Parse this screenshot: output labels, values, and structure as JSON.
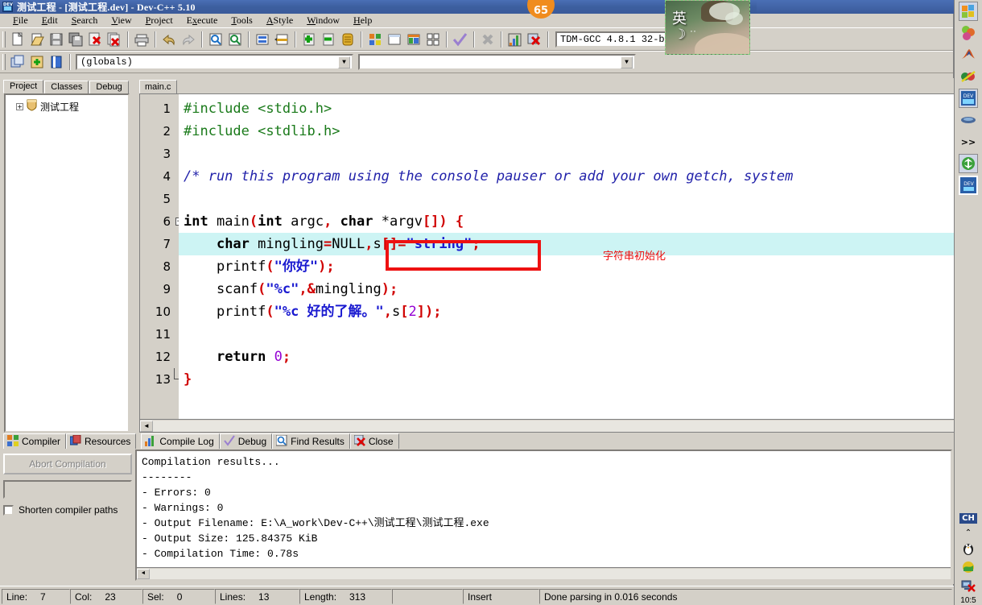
{
  "window": {
    "title": "测试工程 - [测试工程.dev] - Dev-C++ 5.10",
    "icon": "devcpp-icon"
  },
  "menubar": {
    "items": [
      {
        "label": "File",
        "accel": "F"
      },
      {
        "label": "Edit",
        "accel": "E"
      },
      {
        "label": "Search",
        "accel": "S"
      },
      {
        "label": "View",
        "accel": "V"
      },
      {
        "label": "Project",
        "accel": "P"
      },
      {
        "label": "Execute",
        "accel": "x"
      },
      {
        "label": "Tools",
        "accel": "T"
      },
      {
        "label": "AStyle",
        "accel": "A"
      },
      {
        "label": "Window",
        "accel": "W"
      },
      {
        "label": "Help",
        "accel": "H"
      }
    ]
  },
  "toolbar": {
    "row1_icons": [
      "new-file-icon",
      "open-file-icon",
      "save-icon",
      "save-all-icon",
      "close-file-icon",
      "close-all-icon",
      "print-icon",
      "undo-icon",
      "redo-icon",
      "find-icon",
      "find-next-icon",
      "goto-line-icon",
      "replace-icon",
      "add-to-project-icon",
      "remove-from-project-icon",
      "project-options-icon",
      "compile-icon",
      "run-icon",
      "compile-and-run-icon",
      "rebuild-all-icon",
      "syntax-check-icon",
      "stop-execution-icon",
      "profile-icon",
      "delete-profile-icon"
    ],
    "row2_icons": [
      "new-project-icon",
      "add-source-icon",
      "project-manager-icon"
    ],
    "compiler_selector": {
      "value": "TDM-GCC 4.8.1 32-bi",
      "arrow": "chevron-down-icon"
    }
  },
  "class_browser": {
    "value": "(globals)",
    "arrow": "chevron-down-icon",
    "secondary_value": "",
    "secondary_arrow": "chevron-down-icon"
  },
  "left_panel": {
    "tabs": [
      {
        "label": "Project",
        "active": true
      },
      {
        "label": "Classes",
        "active": false
      },
      {
        "label": "Debug",
        "active": false
      }
    ],
    "tree": {
      "expander": "+",
      "icon": "project-shield-icon",
      "label": "测试工程"
    }
  },
  "editor": {
    "tabs": [
      {
        "label": "main.c",
        "active": true
      }
    ],
    "lines": [
      {
        "n": "1",
        "fold": null,
        "tokens": [
          {
            "t": "#include ",
            "c": "pp"
          },
          {
            "t": "<stdio.h>",
            "c": "pp"
          }
        ]
      },
      {
        "n": "2",
        "fold": null,
        "tokens": [
          {
            "t": "#include ",
            "c": "pp"
          },
          {
            "t": "<stdlib.h>",
            "c": "pp"
          }
        ]
      },
      {
        "n": "3",
        "fold": null,
        "tokens": []
      },
      {
        "n": "4",
        "fold": null,
        "tokens": [
          {
            "t": "/* run this program using the console pauser or add your own getch, system",
            "c": "cmt"
          }
        ]
      },
      {
        "n": "5",
        "fold": null,
        "tokens": []
      },
      {
        "n": "6",
        "fold": "-",
        "tokens": [
          {
            "t": "int",
            "c": "kw"
          },
          {
            "t": " main",
            "c": "id"
          },
          {
            "t": "(",
            "c": "pun"
          },
          {
            "t": "int",
            "c": "kw"
          },
          {
            "t": " argc",
            "c": "id"
          },
          {
            "t": ",",
            "c": "pun"
          },
          {
            "t": " ",
            "c": "id"
          },
          {
            "t": "char",
            "c": "kw"
          },
          {
            "t": " *argv",
            "c": "id"
          },
          {
            "t": "[]) {",
            "c": "pun"
          }
        ]
      },
      {
        "n": "7",
        "fold": null,
        "hl": true,
        "tokens": [
          {
            "t": "    ",
            "c": "id"
          },
          {
            "t": "char",
            "c": "kw"
          },
          {
            "t": " mingling",
            "c": "id"
          },
          {
            "t": "=",
            "c": "pun"
          },
          {
            "t": "NULL",
            "c": "id"
          },
          {
            "t": ",",
            "c": "pun"
          },
          {
            "t": "s",
            "c": "id"
          },
          {
            "t": "[]=",
            "c": "pun"
          },
          {
            "t": "\"string\"",
            "c": "str"
          },
          {
            "t": ";",
            "c": "pun"
          }
        ]
      },
      {
        "n": "8",
        "fold": null,
        "tokens": [
          {
            "t": "    printf",
            "c": "id"
          },
          {
            "t": "(",
            "c": "pun"
          },
          {
            "t": "\"你好\"",
            "c": "str"
          },
          {
            "t": ");",
            "c": "pun"
          }
        ]
      },
      {
        "n": "9",
        "fold": null,
        "tokens": [
          {
            "t": "    scanf",
            "c": "id"
          },
          {
            "t": "(",
            "c": "pun"
          },
          {
            "t": "\"%c\"",
            "c": "str"
          },
          {
            "t": ",",
            "c": "pun"
          },
          {
            "t": "&",
            "c": "pun"
          },
          {
            "t": "mingling",
            "c": "id"
          },
          {
            "t": ");",
            "c": "pun"
          }
        ]
      },
      {
        "n": "10",
        "fold": null,
        "tokens": [
          {
            "t": "    printf",
            "c": "id"
          },
          {
            "t": "(",
            "c": "pun"
          },
          {
            "t": "\"%c 好的了解。\"",
            "c": "str"
          },
          {
            "t": ",",
            "c": "pun"
          },
          {
            "t": "s",
            "c": "id"
          },
          {
            "t": "[",
            "c": "pun"
          },
          {
            "t": "2",
            "c": "num"
          },
          {
            "t": "]);",
            "c": "pun"
          }
        ]
      },
      {
        "n": "11",
        "fold": null,
        "tokens": []
      },
      {
        "n": "12",
        "fold": null,
        "tokens": [
          {
            "t": "    ",
            "c": "id"
          },
          {
            "t": "return",
            "c": "kw"
          },
          {
            "t": " ",
            "c": "id"
          },
          {
            "t": "0",
            "c": "num"
          },
          {
            "t": ";",
            "c": "pun"
          }
        ]
      },
      {
        "n": "13",
        "fold": "L",
        "tokens": [
          {
            "t": "}",
            "c": "pun"
          }
        ]
      }
    ],
    "annotation": {
      "text": "字符串初始化",
      "box_color": "#ee1111",
      "text_color": "#ee1111"
    }
  },
  "bottom_panel": {
    "left_tabs": [
      {
        "label": "Compiler",
        "icon": "compiler-icon",
        "active": true
      },
      {
        "label": "Resources",
        "icon": "resources-icon",
        "active": false
      }
    ],
    "right_tabs": [
      {
        "label": "Compile Log",
        "icon": "chart-icon",
        "active": true
      },
      {
        "label": "Debug",
        "icon": "check-icon",
        "active": false
      },
      {
        "label": "Find Results",
        "icon": "find-icon",
        "active": false
      },
      {
        "label": "Close",
        "icon": "close-x-icon",
        "active": false
      }
    ],
    "abort_button": "Abort Compilation",
    "shorten_paths_label": "Shorten compiler paths",
    "shorten_paths_checked": false,
    "log_lines": [
      "Compilation results...",
      "--------",
      "- Errors: 0",
      "- Warnings: 0",
      "- Output Filename: E:\\A_work\\Dev-C++\\测试工程\\测试工程.exe",
      "- Output Size: 125.84375 KiB",
      "- Compilation Time: 0.78s"
    ]
  },
  "statusbar": {
    "line_label": "Line:",
    "line_value": "7",
    "col_label": "Col:",
    "col_value": "23",
    "sel_label": "Sel:",
    "sel_value": "0",
    "lines_label": "Lines:",
    "lines_value": "13",
    "length_label": "Length:",
    "length_value": "313",
    "mode": "Insert",
    "message": "Done parsing in 0.016 seconds"
  },
  "tray": {
    "icons": [
      "windows-start-icon",
      "color-balls-icon",
      "matlab-icon",
      "opera-icon",
      "devcpp-icon",
      "media-icon",
      "chevron-right-right-icon",
      "ie-browser-icon",
      "devcpp-active-icon"
    ],
    "bottom_icons": [
      "ime-ch-icon",
      "caret-up-icon",
      "qq-penguin-icon",
      "globe-icon",
      "network-error-icon"
    ],
    "ime_text": "CH",
    "time": "10:5"
  },
  "overlays": {
    "ime_float_char": "英",
    "badge_value": "65"
  },
  "colors": {
    "title_blue": "#3d5f9f",
    "face": "#d4d0c8",
    "highlight_line": "#cdf4f4",
    "annotation_red": "#ee1111",
    "string_blue": "#1a1ad0",
    "comment_blue": "#2222aa",
    "preproc_green": "#1a7a1a"
  }
}
